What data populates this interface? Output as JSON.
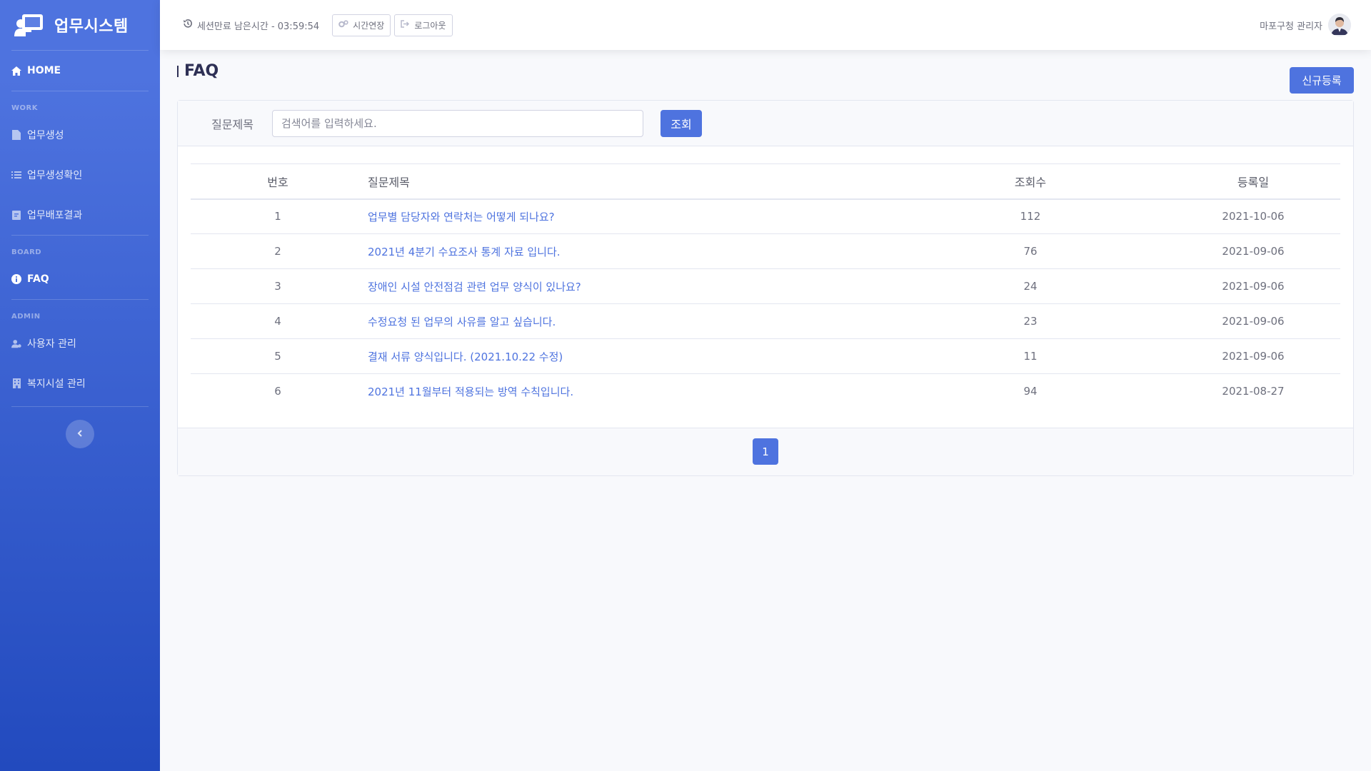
{
  "brand": {
    "title": "업무시스템"
  },
  "sidebar": {
    "home": "HOME",
    "sections": [
      {
        "heading": "WORK",
        "items": [
          "업무생성",
          "업무생성확인",
          "업무배포결과"
        ]
      },
      {
        "heading": "BOARD",
        "items": [
          "FAQ"
        ]
      },
      {
        "heading": "ADMIN",
        "items": [
          "사용자 관리",
          "복지시설 관리"
        ]
      }
    ],
    "active_item": "FAQ"
  },
  "topbar": {
    "session_label": "세션만료 남은시간 - 03:59:54",
    "extend_button": "시간연장",
    "logout_button": "로그아웃",
    "user_name": "마포구청 관리자"
  },
  "page": {
    "title": "FAQ",
    "new_button": "신규등록"
  },
  "search": {
    "label": "질문제목",
    "placeholder": "검색어를 입력하세요.",
    "button": "조회"
  },
  "table": {
    "headers": [
      "번호",
      "질문제목",
      "조회수",
      "등록일"
    ],
    "rows": [
      {
        "num": "1",
        "title": "업무별 담당자와 연락처는 어떻게 되나요?",
        "views": "112",
        "date": "2021-10-06"
      },
      {
        "num": "2",
        "title": "2021년 4분기 수요조사 통계 자료 입니다.",
        "views": "76",
        "date": "2021-09-06"
      },
      {
        "num": "3",
        "title": "장애인 시설 안전점검 관련 업무 양식이 있나요?",
        "views": "24",
        "date": "2021-09-06"
      },
      {
        "num": "4",
        "title": "수정요청 된 업무의 사유를 알고 싶습니다.",
        "views": "23",
        "date": "2021-09-06"
      },
      {
        "num": "5",
        "title": "결재 서류 양식입니다. (2021.10.22 수정)",
        "views": "11",
        "date": "2021-09-06"
      },
      {
        "num": "6",
        "title": "2021년 11월부터 적용되는 방역 수칙입니다.",
        "views": "94",
        "date": "2021-08-27"
      }
    ]
  },
  "pagination": {
    "current": "1"
  },
  "colors": {
    "primary": "#4e73df",
    "sidebar_dark": "#224abe",
    "background": "#f8f9fc"
  }
}
